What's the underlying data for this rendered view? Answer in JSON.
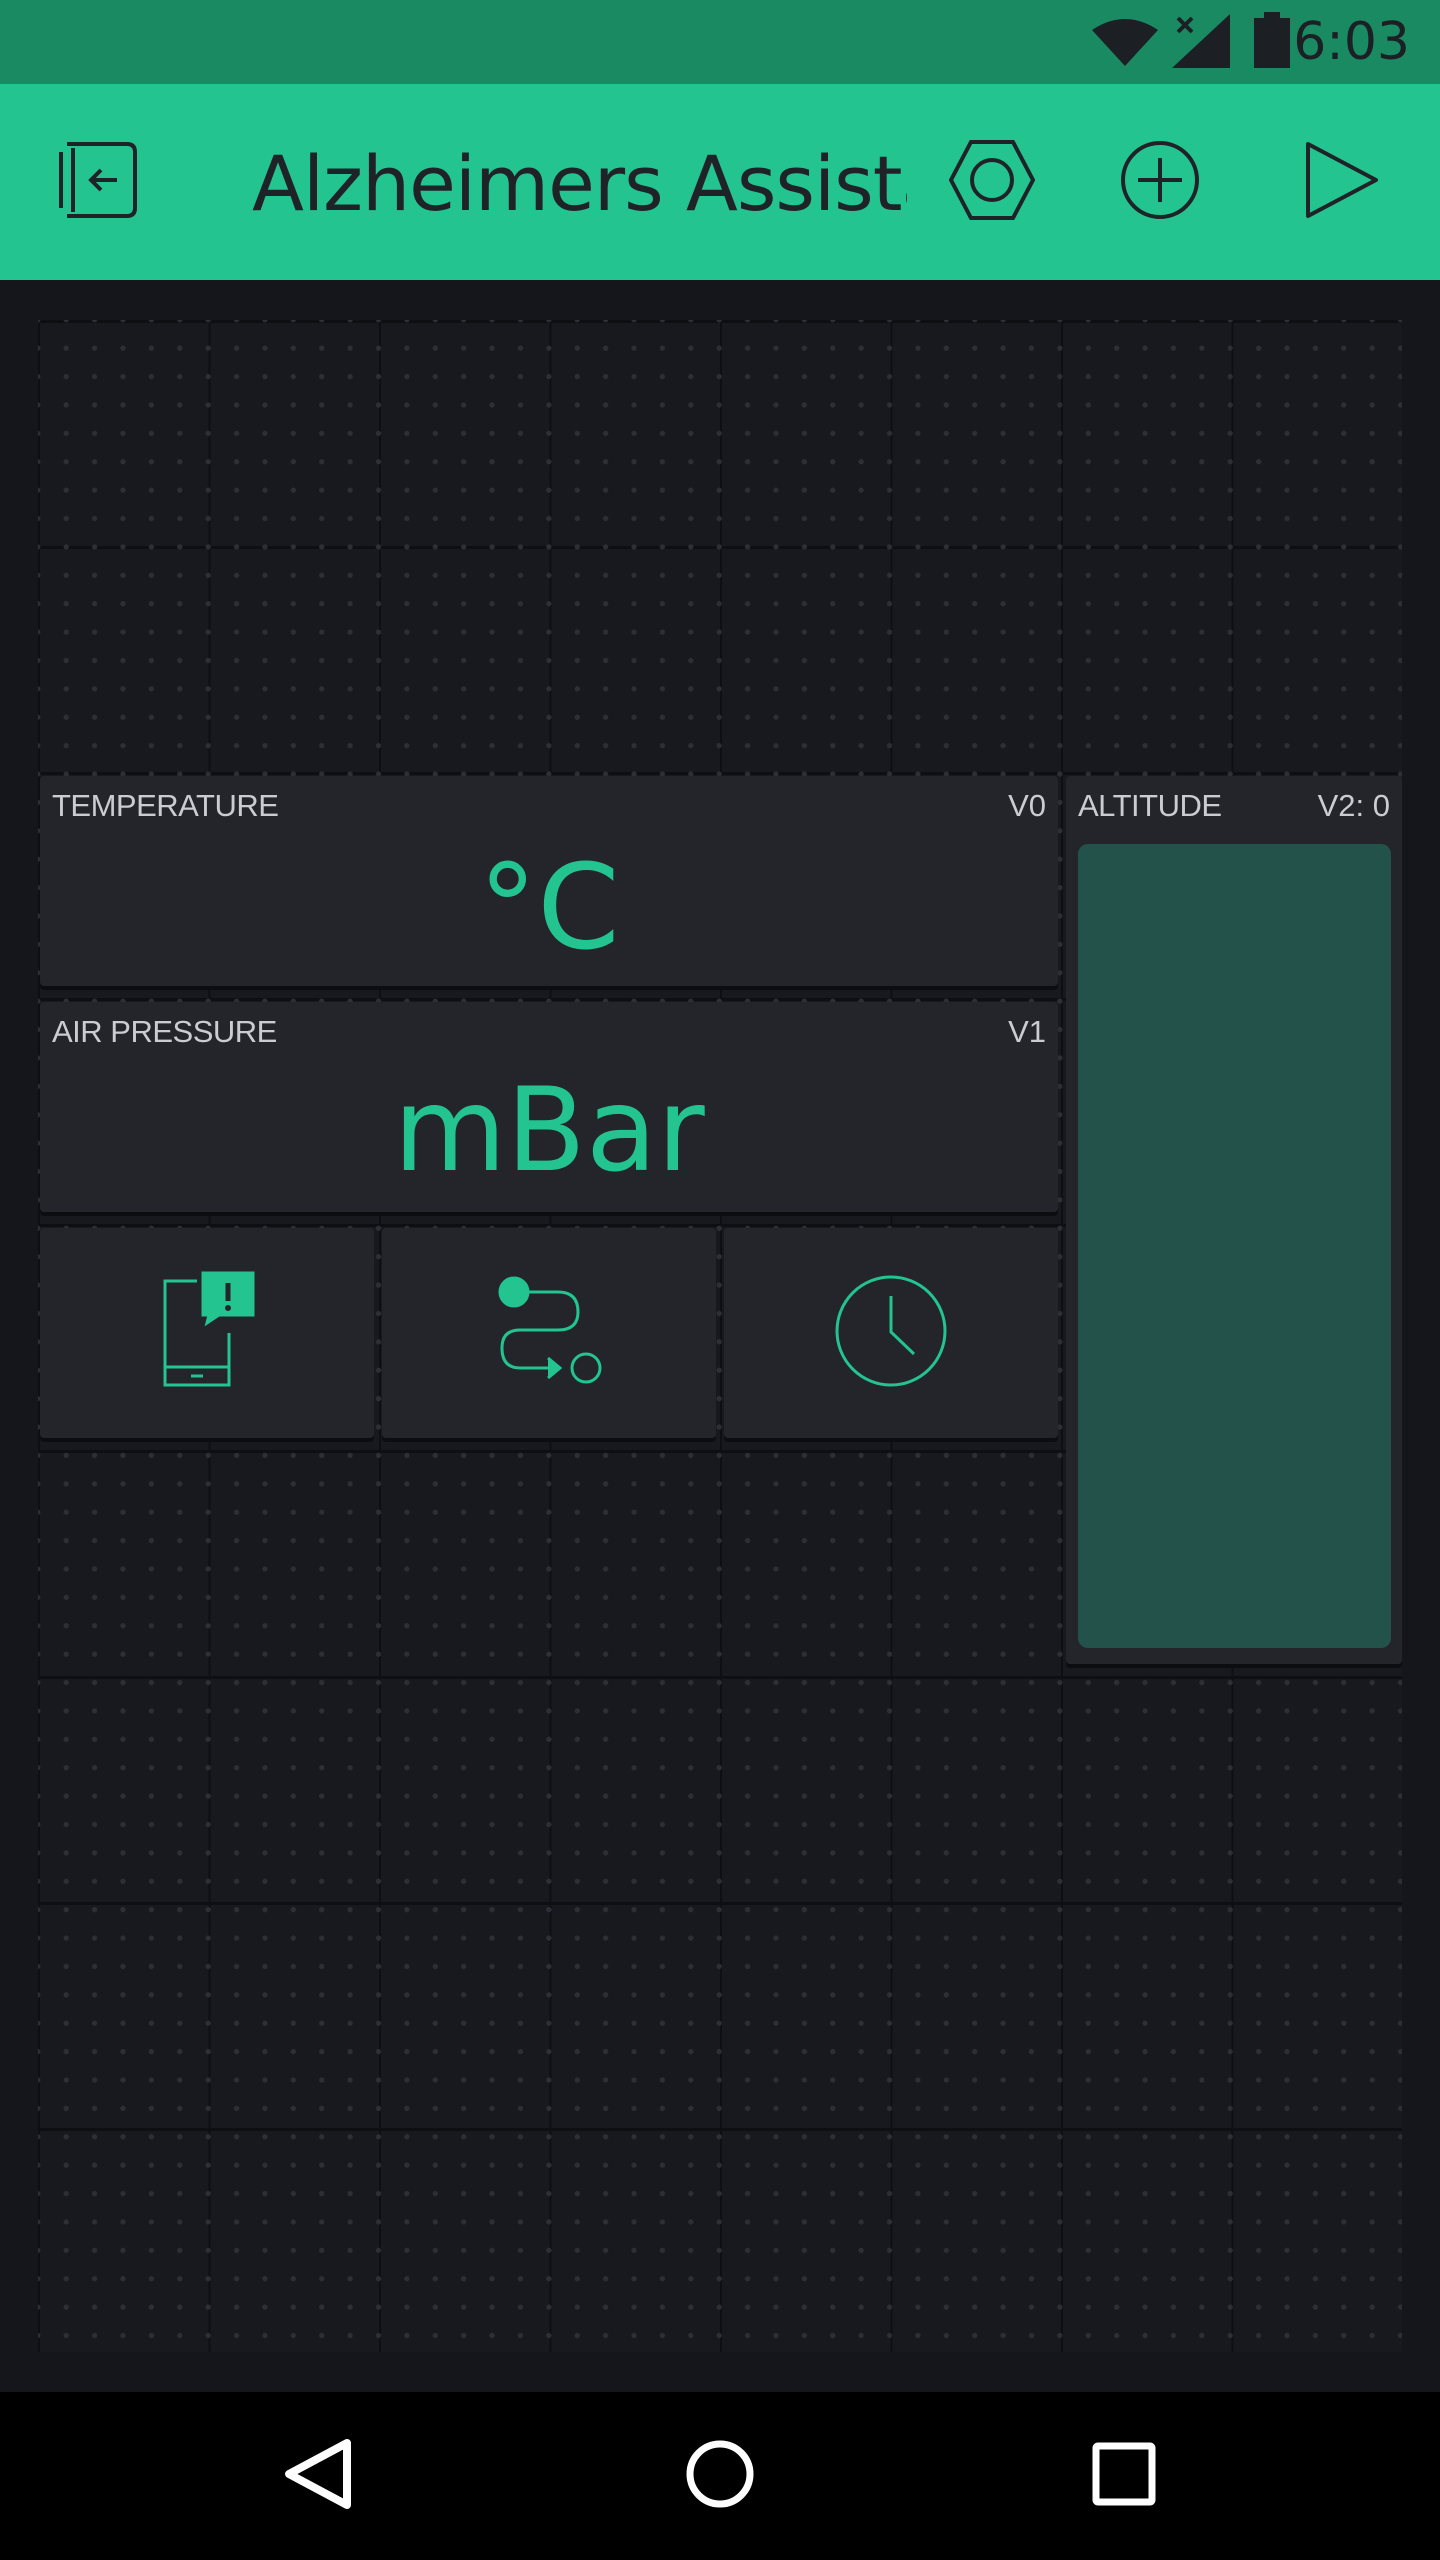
{
  "status_bar": {
    "time": "6:03",
    "icons": [
      "wifi-icon",
      "signal-icon",
      "battery-icon"
    ]
  },
  "app_bar": {
    "title": "Alzheimers Assistant",
    "actions": [
      "exit-icon",
      "settings-icon",
      "add-icon",
      "play-icon"
    ]
  },
  "widgets": {
    "temperature": {
      "label": "TEMPERATURE",
      "pin": "V0",
      "value": "°C"
    },
    "air_pressure": {
      "label": "AIR PRESSURE",
      "pin": "V1",
      "value": "mBar"
    },
    "altitude": {
      "label": "ALTITUDE",
      "pin": "V2: 0",
      "level": 0
    },
    "tiles": [
      "notification-icon",
      "eventor-icon",
      "timer-icon"
    ]
  },
  "colors": {
    "accent": "#23c48f",
    "status_bar": "#1a8a63",
    "background": "#14161b",
    "widget": "#23252b",
    "bar_fill": "#22524a"
  },
  "nav_bar": {
    "buttons": [
      "back-icon",
      "home-icon",
      "recents-icon"
    ]
  }
}
